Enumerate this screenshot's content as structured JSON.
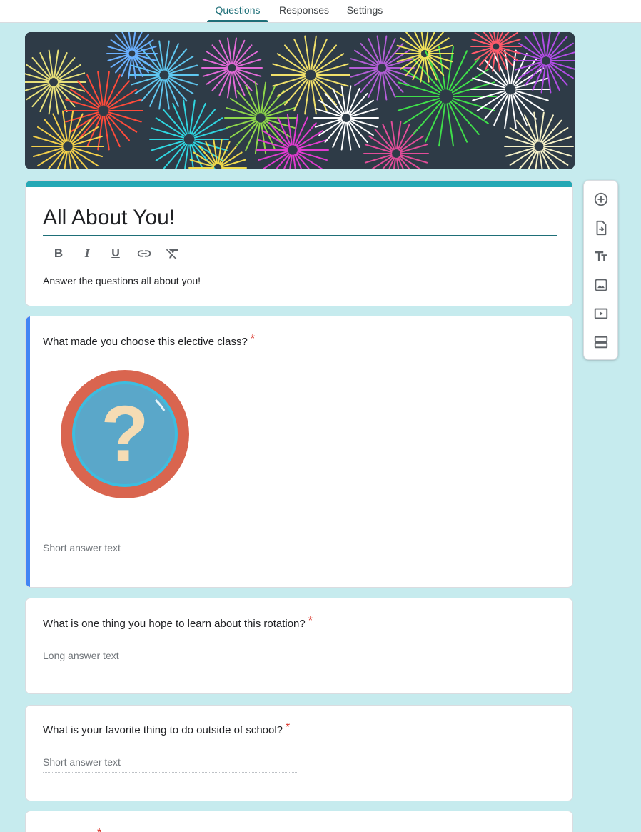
{
  "tabs": {
    "questions": "Questions",
    "responses": "Responses",
    "settings": "Settings"
  },
  "form": {
    "title": "All About You!",
    "description": "Answer the questions all about you!",
    "accent_color": "#26a8b5",
    "active_color": "#1e6f78"
  },
  "toolbar": {
    "bold": "B",
    "italic": "I",
    "underline": "U"
  },
  "questions": [
    {
      "title": "What made you choose this elective class?",
      "required_mark": "*",
      "answer_hint": "Short answer text",
      "image": "question-mark-image"
    },
    {
      "title": "What is one thing you hope to learn about this rotation?",
      "required_mark": "*",
      "answer_hint": "Long answer text"
    },
    {
      "title": "What is your favorite thing to do outside of school?",
      "required_mark": "*",
      "answer_hint": "Short answer text"
    },
    {
      "title": "",
      "required_mark": "*"
    }
  ],
  "side_tools": [
    "add-question-icon",
    "import-questions-icon",
    "add-title-icon",
    "add-image-icon",
    "add-video-icon",
    "add-section-icon"
  ]
}
